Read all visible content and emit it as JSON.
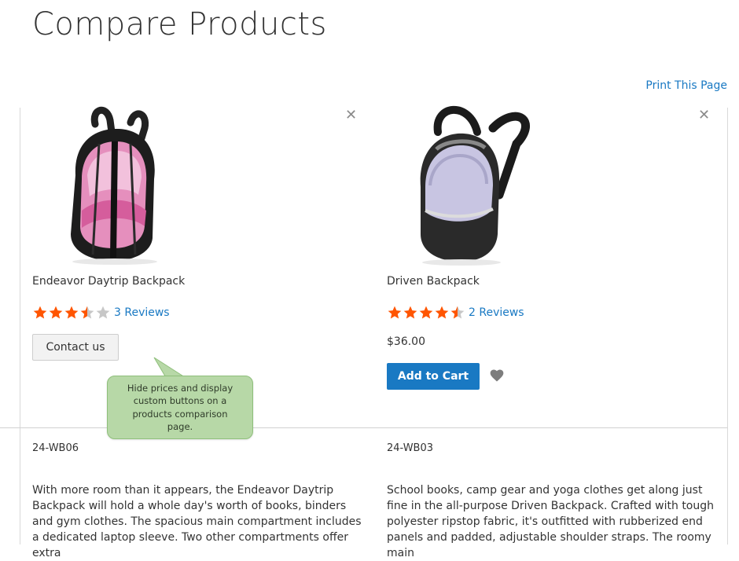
{
  "page": {
    "title": "Compare Products",
    "print_label": "Print This Page"
  },
  "products": [
    {
      "name": "Endeavor Daytrip Backpack",
      "rating_fraction": 0.7,
      "reviews": "3 Reviews",
      "action_label": "Contact us",
      "remove_icon": "close-icon",
      "sku": "24-WB06",
      "description": "With more room than it appears, the Endeavor Daytrip Backpack will hold a whole day's worth of books, binders and gym clothes. The spacious main compartment includes a dedicated laptop sleeve. Two other compartments offer extra"
    },
    {
      "name": "Driven Backpack",
      "rating_fraction": 0.9,
      "reviews": "2 Reviews",
      "price": "$36.00",
      "action_label": "Add to Cart",
      "wishlist_icon": "heart-icon",
      "remove_icon": "close-icon",
      "sku": "24-WB03",
      "description": "School books, camp gear and yoga clothes get along just fine in the all-purpose Driven Backpack. Crafted with tough polyester ripstop fabric, it's outfitted with rubberized end panels and padded, adjustable shoulder straps. The roomy main"
    }
  ],
  "callout": {
    "text": "Hide prices and display custom buttons on a products comparison page."
  },
  "colors": {
    "accent": "#1979c3",
    "star": "#ff5501",
    "star_empty": "#c7c7c7",
    "callout_bg": "#b7d8a7"
  }
}
